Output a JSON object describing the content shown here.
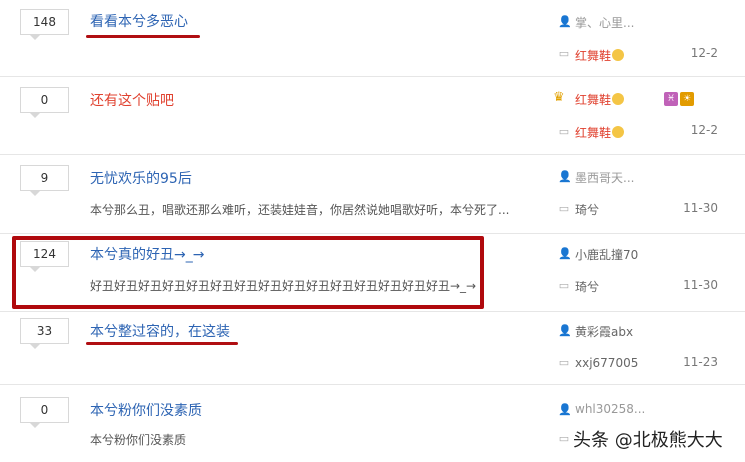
{
  "threads": [
    {
      "count": "148",
      "title": "看看本兮多恶心",
      "author": "掌、心里...",
      "last_reply_user": "红舞鞋",
      "date": "12-2"
    },
    {
      "count": "0",
      "title": "还有这个贴吧",
      "author": "红舞鞋",
      "last_reply_user": "红舞鞋",
      "date": "12-2"
    },
    {
      "count": "9",
      "title": "无忧欢乐的95后",
      "abstract": "本兮那么丑，唱歌还那么难听，还装娃娃音，你居然说她唱歌好听，本兮死了...",
      "author": "墨西哥天...",
      "last_reply_user": "琦兮",
      "date": "11-30"
    },
    {
      "count": "124",
      "title": "本兮真的好丑→_→",
      "abstract": "好丑好丑好丑好丑好丑好丑好丑好丑好丑好丑好丑好丑好丑好丑好丑→_→",
      "author": "小鹿乱撞70",
      "last_reply_user": "琦兮",
      "date": "11-30"
    },
    {
      "count": "33",
      "title": "本兮整过容的，在这装",
      "author": "黄彩霞abx",
      "last_reply_user": "xxj677005",
      "date": "11-23"
    },
    {
      "count": "0",
      "title": "本兮粉你们没素质",
      "abstract": "本兮粉你们没素质",
      "author": "whl30258...",
      "last_reply_user": "",
      "date": ""
    }
  ],
  "badges": {
    "pisces": "♓",
    "sun": "☀"
  },
  "watermark": "头条 @北极熊大大",
  "colors": {
    "link": "#2d64b3",
    "hot": "#e0412f",
    "annotation": "#b0090d"
  }
}
